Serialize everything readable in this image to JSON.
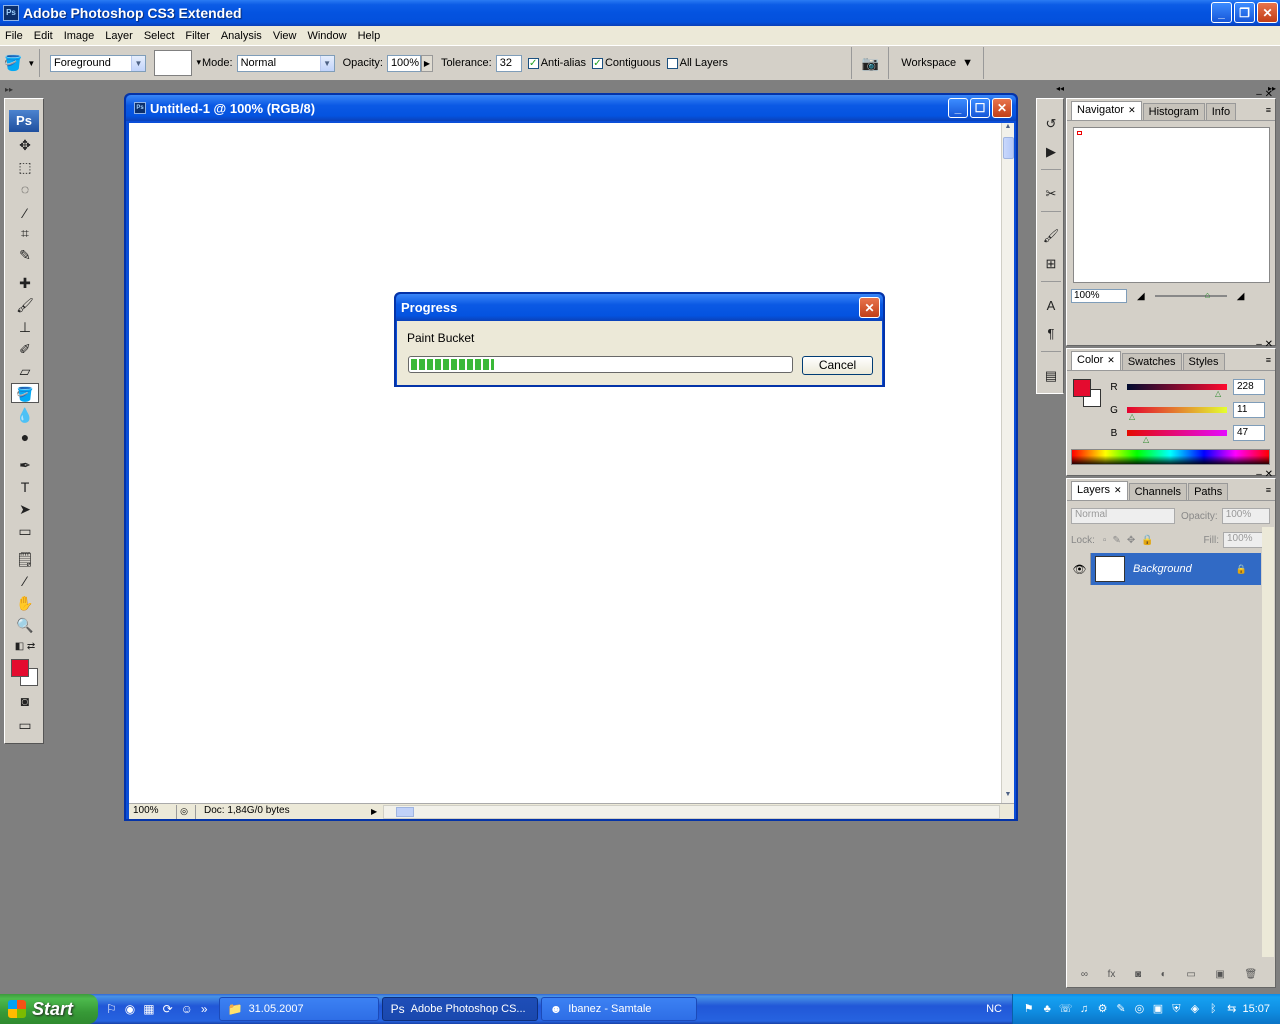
{
  "app": {
    "title": "Adobe Photoshop CS3 Extended",
    "logo": "Ps"
  },
  "menu": [
    "File",
    "Edit",
    "Image",
    "Layer",
    "Select",
    "Filter",
    "Analysis",
    "View",
    "Window",
    "Help"
  ],
  "options": {
    "fill_source": "Foreground",
    "mode_label": "Mode:",
    "mode_value": "Normal",
    "opacity_label": "Opacity:",
    "opacity_value": "100%",
    "tolerance_label": "Tolerance:",
    "tolerance_value": "32",
    "antialias_label": "Anti-alias",
    "contiguous_label": "Contiguous",
    "all_layers_label": "All Layers",
    "workspace_label": "Workspace"
  },
  "document": {
    "title": "Untitled-1 @ 100% (RGB/8)",
    "zoom": "100%",
    "doc_info": "Doc: 1,84G/0 bytes"
  },
  "progress": {
    "title": "Progress",
    "label": "Paint Bucket",
    "value_fraction": 0.22,
    "cancel_label": "Cancel"
  },
  "panels": {
    "navigator_tabs": [
      "Navigator",
      "Histogram",
      "Info"
    ],
    "navigator_zoom": "100%",
    "color_tabs": [
      "Color",
      "Swatches",
      "Styles"
    ],
    "color": {
      "r_label": "R",
      "r_value": "228",
      "g_label": "G",
      "g_value": "11",
      "b_label": "B",
      "b_value": "47",
      "foreground_hex": "#e40b2f"
    },
    "layers_tabs": [
      "Layers",
      "Channels",
      "Paths"
    ],
    "layers": {
      "blend_mode": "Normal",
      "opacity_label": "Opacity:",
      "opacity_value": "100%",
      "lock_label": "Lock:",
      "fill_label": "Fill:",
      "fill_value": "100%",
      "items": [
        {
          "name": "Background"
        }
      ]
    }
  },
  "taskbar": {
    "start_label": "Start",
    "tasks": [
      "31.05.2007",
      "Adobe Photoshop CS...",
      "Ibanez - Samtale"
    ],
    "language": "NC",
    "clock": "15:07"
  }
}
